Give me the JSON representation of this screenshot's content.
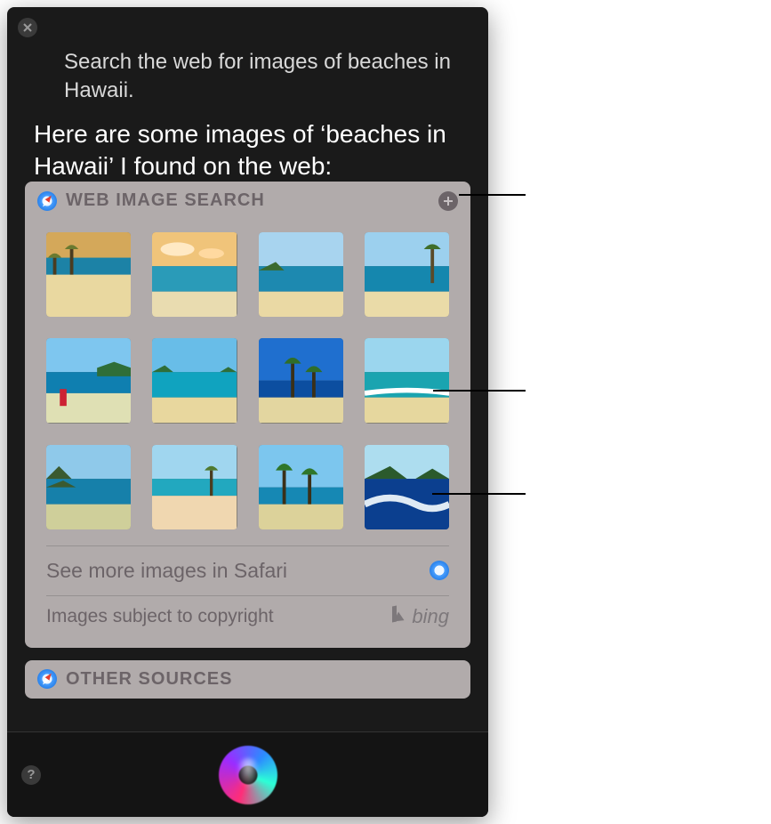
{
  "query": "Search the web for images of beaches in Hawaii.",
  "response": "Here are some images of ‘beaches in Hawaii’ I found on the web:",
  "card": {
    "title": "WEB IMAGE SEARCH",
    "more_label": "See more images in Safari",
    "copyright_label": "Images subject to copyright",
    "provider": "bing"
  },
  "other_card": {
    "title": "OTHER SOURCES"
  },
  "icons": {
    "close": "close-icon",
    "add": "add-icon",
    "safari": "safari-icon",
    "help": "help-icon",
    "siri": "siri-orb-icon",
    "bing": "bing-logo-icon"
  },
  "help_glyph": "?"
}
